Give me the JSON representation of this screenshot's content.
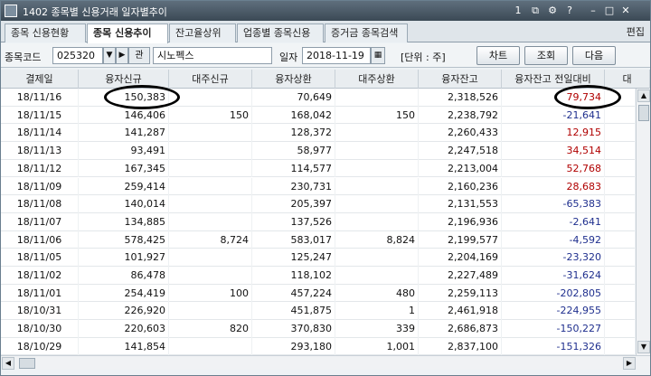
{
  "titlebar": {
    "title": "1402 종목별 신용거래 일자별추이",
    "buttons": [
      "1",
      "⧉",
      "⚙",
      "?",
      "–",
      "□",
      "✕"
    ]
  },
  "tabs": [
    {
      "label": "종목 신용현황",
      "active": false
    },
    {
      "label": "종목 신용추이",
      "active": true
    },
    {
      "label": "잔고율상위",
      "active": false
    },
    {
      "label": "업종별 종목신용",
      "active": false
    },
    {
      "label": "증거금 종목검색",
      "active": false
    }
  ],
  "edit_label": "편집",
  "toolbar": {
    "code_label": "종목코드",
    "code_value": "025320",
    "name_value": "시노펙스",
    "date_label": "일자",
    "date_value": "2018-11-19",
    "unit_label": "[단위 : 주]",
    "chart_btn": "차트",
    "search_btn": "조회",
    "next_btn": "다음",
    "small_btn": "관"
  },
  "columns": [
    "결제일",
    "융자신규",
    "대주신규",
    "융자상환",
    "대주상환",
    "융자잔고",
    "융자잔고 전일대비",
    "대"
  ],
  "rows": [
    {
      "date": "18/11/16",
      "new_loan": "150,383",
      "new_short": "",
      "loan_repay": "70,649",
      "short_repay": "",
      "balance": "2,318,526",
      "change": "79,734",
      "dir": "pos"
    },
    {
      "date": "18/11/15",
      "new_loan": "146,406",
      "new_short": "150",
      "loan_repay": "168,042",
      "short_repay": "150",
      "balance": "2,238,792",
      "change": "-21,641",
      "dir": "neg"
    },
    {
      "date": "18/11/14",
      "new_loan": "141,287",
      "new_short": "",
      "loan_repay": "128,372",
      "short_repay": "",
      "balance": "2,260,433",
      "change": "12,915",
      "dir": "pos"
    },
    {
      "date": "18/11/13",
      "new_loan": "93,491",
      "new_short": "",
      "loan_repay": "58,977",
      "short_repay": "",
      "balance": "2,247,518",
      "change": "34,514",
      "dir": "pos"
    },
    {
      "date": "18/11/12",
      "new_loan": "167,345",
      "new_short": "",
      "loan_repay": "114,577",
      "short_repay": "",
      "balance": "2,213,004",
      "change": "52,768",
      "dir": "pos"
    },
    {
      "date": "18/11/09",
      "new_loan": "259,414",
      "new_short": "",
      "loan_repay": "230,731",
      "short_repay": "",
      "balance": "2,160,236",
      "change": "28,683",
      "dir": "pos"
    },
    {
      "date": "18/11/08",
      "new_loan": "140,014",
      "new_short": "",
      "loan_repay": "205,397",
      "short_repay": "",
      "balance": "2,131,553",
      "change": "-65,383",
      "dir": "neg"
    },
    {
      "date": "18/11/07",
      "new_loan": "134,885",
      "new_short": "",
      "loan_repay": "137,526",
      "short_repay": "",
      "balance": "2,196,936",
      "change": "-2,641",
      "dir": "neg"
    },
    {
      "date": "18/11/06",
      "new_loan": "578,425",
      "new_short": "8,724",
      "loan_repay": "583,017",
      "short_repay": "8,824",
      "balance": "2,199,577",
      "change": "-4,592",
      "dir": "neg"
    },
    {
      "date": "18/11/05",
      "new_loan": "101,927",
      "new_short": "",
      "loan_repay": "125,247",
      "short_repay": "",
      "balance": "2,204,169",
      "change": "-23,320",
      "dir": "neg"
    },
    {
      "date": "18/11/02",
      "new_loan": "86,478",
      "new_short": "",
      "loan_repay": "118,102",
      "short_repay": "",
      "balance": "2,227,489",
      "change": "-31,624",
      "dir": "neg"
    },
    {
      "date": "18/11/01",
      "new_loan": "254,419",
      "new_short": "100",
      "loan_repay": "457,224",
      "short_repay": "480",
      "balance": "2,259,113",
      "change": "-202,805",
      "dir": "neg"
    },
    {
      "date": "18/10/31",
      "new_loan": "226,920",
      "new_short": "",
      "loan_repay": "451,875",
      "short_repay": "1",
      "balance": "2,461,918",
      "change": "-224,955",
      "dir": "neg"
    },
    {
      "date": "18/10/30",
      "new_loan": "220,603",
      "new_short": "820",
      "loan_repay": "370,830",
      "short_repay": "339",
      "balance": "2,686,873",
      "change": "-150,227",
      "dir": "neg"
    },
    {
      "date": "18/10/29",
      "new_loan": "141,854",
      "new_short": "",
      "loan_repay": "293,180",
      "short_repay": "1,001",
      "balance": "2,837,100",
      "change": "-151,326",
      "dir": "neg"
    }
  ],
  "colors": {
    "positive": "#b00000",
    "negative": "#1f2f8e",
    "titlebar": "#4a5966"
  }
}
